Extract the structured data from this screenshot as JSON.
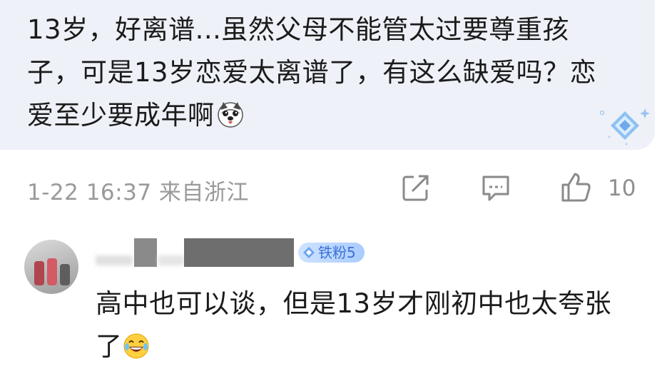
{
  "comment": {
    "text": "13岁，好离谱...虽然父母不能管太过要尊重孩子，可是13岁恋爱太离谱了，有这么缺爱吗？恋爱至少要成年啊",
    "emoji_icon": "husky-emoji-icon"
  },
  "meta": {
    "timestamp": "1-22 16:37 来自浙江",
    "like_count": "10"
  },
  "reply": {
    "fan_badge": "铁粉5",
    "text": "高中也可以谈，但是13岁才刚初中也太夸张了",
    "emoji_icon": "laughing-emoji-icon"
  },
  "colors": {
    "bubble_bg": "#eef1f7",
    "meta_text": "#9a9a9a",
    "badge_blue": "#3d6fd6"
  }
}
